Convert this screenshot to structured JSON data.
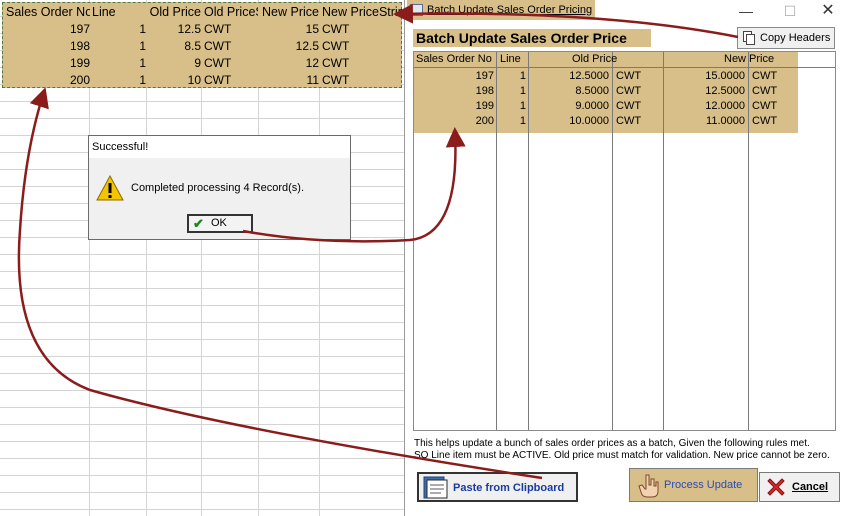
{
  "sheet": {
    "headers": [
      "Sales Order No",
      "Line",
      "Old Price",
      "Old PriceS",
      "New Price",
      "New PriceStrin"
    ],
    "rows": [
      [
        "197",
        "1",
        "12.5",
        "CWT",
        "15",
        "CWT"
      ],
      [
        "198",
        "1",
        "8.5",
        "CWT",
        "12.5",
        "CWT"
      ],
      [
        "199",
        "1",
        "9",
        "CWT",
        "12",
        "CWT"
      ],
      [
        "200",
        "1",
        "10",
        "CWT",
        "11",
        "CWT"
      ]
    ]
  },
  "window": {
    "title": "Batch Update Sales Order Pricing",
    "heading": "Batch Update Sales Order Price",
    "copy_headers_label": "Copy Headers",
    "columns": [
      "Sales Order No",
      "Line",
      "Old Price",
      "New Price"
    ],
    "rows": [
      [
        "197",
        "1",
        "12.5000",
        "CWT",
        "15.0000",
        "CWT"
      ],
      [
        "198",
        "1",
        "8.5000",
        "CWT",
        "12.5000",
        "CWT"
      ],
      [
        "199",
        "1",
        "9.0000",
        "CWT",
        "12.0000",
        "CWT"
      ],
      [
        "200",
        "1",
        "10.0000",
        "CWT",
        "11.0000",
        "CWT"
      ]
    ],
    "help_line1": "This helps update a bunch of sales order prices as a batch, Given the following rules met.",
    "help_line2": "SO Line item must be ACTIVE. Old price must match for validation. New price cannot be zero.",
    "paste_label": "Paste from Clipboard",
    "process_label": "Process Update",
    "cancel_label": "Cancel",
    "min_glyph": "—",
    "max_glyph": "☐",
    "close_glyph": "✕"
  },
  "dialog": {
    "title": "Successful!",
    "message": "Completed processing 4 Record(s).",
    "ok_label": "OK"
  },
  "colors": {
    "highlight": "#d8bf8a",
    "arrow": "#8b1c1c"
  },
  "icons": [
    "app-icon",
    "copy-icon",
    "warning-icon",
    "check-icon",
    "paste-icon",
    "hand-icon",
    "cancel-x-icon"
  ]
}
